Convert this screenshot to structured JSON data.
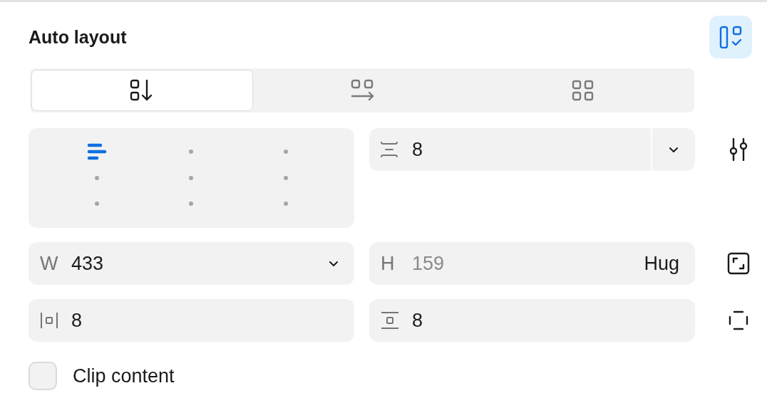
{
  "title": "Auto layout",
  "layout_toggle": {
    "on": true
  },
  "directions": [
    {
      "kind": "vertical",
      "selected": true
    },
    {
      "kind": "horizontal",
      "selected": false
    },
    {
      "kind": "wrap",
      "selected": false
    }
  ],
  "alignment": [
    {
      "selected": true
    },
    {
      "selected": false
    },
    {
      "selected": false
    },
    {
      "selected": false
    },
    {
      "selected": false
    },
    {
      "selected": false
    },
    {
      "selected": false
    },
    {
      "selected": false
    },
    {
      "selected": false
    }
  ],
  "gap": {
    "value": "8"
  },
  "width": {
    "label": "W",
    "value": "433"
  },
  "height": {
    "label": "H",
    "value": "159",
    "disabled": true,
    "mode": "Hug"
  },
  "padding_horizontal": {
    "value": "8"
  },
  "padding_vertical": {
    "value": "8"
  },
  "clip_content": {
    "label": "Clip content",
    "checked": false
  }
}
